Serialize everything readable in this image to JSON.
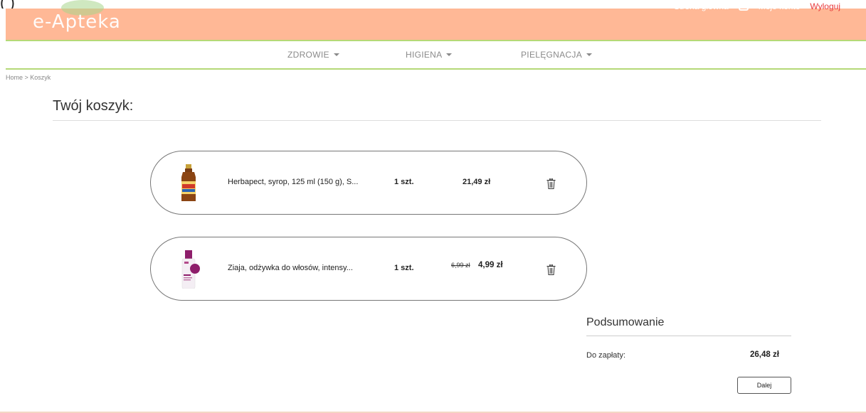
{
  "top_overflow_text": "(shop is full of clipped header content)",
  "header": {
    "logo": "e-Apteka",
    "links": {
      "home": "Strona główna",
      "account": "Moje konto",
      "logout": "Wyloguj"
    },
    "accent_color": "#ffb896",
    "border_color": "#b5d977",
    "logout_color": "#e8393a"
  },
  "nav": {
    "items": [
      {
        "label": "ZDROWIE"
      },
      {
        "label": "HIGIENA"
      },
      {
        "label": "PIELĘGNACJA"
      }
    ]
  },
  "breadcrumb": "Home > Koszyk",
  "page_title": "Twój koszyk:",
  "cart": {
    "items": [
      {
        "name": "Herbapect, syrop, 125 ml (150 g), S...",
        "qty": "1 szt.",
        "price": "21,49 zł",
        "old_price": "",
        "icon": "trash-icon"
      },
      {
        "name": "Ziaja, odżywka do włosów, intensy...",
        "qty": "1 szt.",
        "price": "4,99 zł",
        "old_price": "6,99 zł",
        "icon": "trash-icon"
      }
    ]
  },
  "summary": {
    "title": "Podsumowanie",
    "label": "Do zapłaty:",
    "total": "26,48 zł",
    "next_label": "Dalej"
  }
}
